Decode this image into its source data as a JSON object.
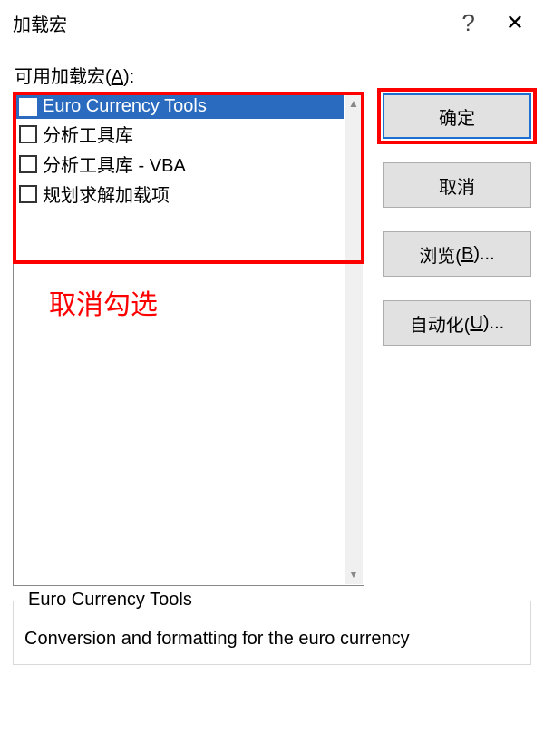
{
  "dialog": {
    "title": "加载宏",
    "help_glyph": "?",
    "close_glyph": "✕",
    "list_label_pre": "可用加载宏(",
    "list_label_key": "A",
    "list_label_post": "):"
  },
  "items": [
    {
      "label": "Euro Currency Tools",
      "selected": true
    },
    {
      "label": "分析工具库",
      "selected": false
    },
    {
      "label": "分析工具库 - VBA",
      "selected": false
    },
    {
      "label": "规划求解加载项",
      "selected": false
    }
  ],
  "buttons": {
    "ok": "确定",
    "cancel": "取消",
    "browse_pre": "浏览(",
    "browse_key": "B",
    "browse_post": ")...",
    "automation_pre": "自动化(",
    "automation_key": "U",
    "automation_post": ")..."
  },
  "annotation": "取消勾选",
  "description": {
    "title": "Euro Currency Tools",
    "body": "Conversion and formatting for the euro currency"
  },
  "scroll": {
    "up": "▲",
    "down": "▼"
  }
}
